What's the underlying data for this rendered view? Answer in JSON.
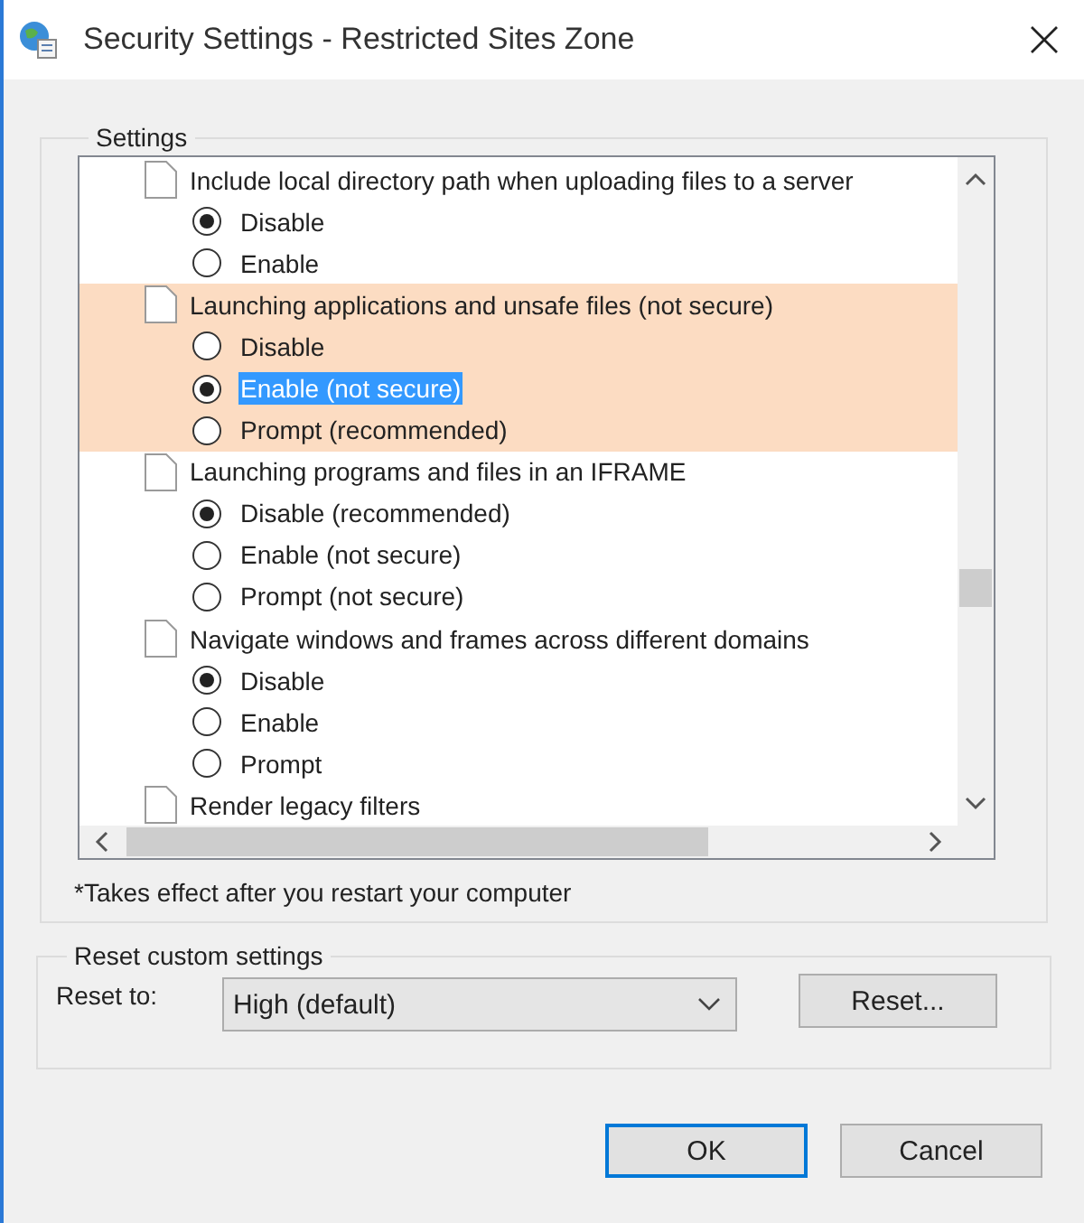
{
  "window": {
    "title": "Security Settings - Restricted Sites Zone"
  },
  "settings": {
    "title": "Settings",
    "items": [
      {
        "label": "Include local directory path when uploading files to a server",
        "highlighted": false,
        "options": [
          {
            "label": "Disable",
            "checked": true,
            "selected": false
          },
          {
            "label": "Enable",
            "checked": false,
            "selected": false
          }
        ]
      },
      {
        "label": "Launching applications and unsafe files (not secure)",
        "highlighted": true,
        "options": [
          {
            "label": "Disable",
            "checked": false,
            "selected": false
          },
          {
            "label": "Enable (not secure)",
            "checked": true,
            "selected": true
          },
          {
            "label": "Prompt (recommended)",
            "checked": false,
            "selected": false
          }
        ]
      },
      {
        "label": "Launching programs and files in an IFRAME",
        "highlighted": false,
        "options": [
          {
            "label": "Disable (recommended)",
            "checked": true,
            "selected": false
          },
          {
            "label": "Enable (not secure)",
            "checked": false,
            "selected": false
          },
          {
            "label": "Prompt (not secure)",
            "checked": false,
            "selected": false
          }
        ]
      },
      {
        "label": "Navigate windows and frames across different domains",
        "highlighted": false,
        "options": [
          {
            "label": "Disable",
            "checked": true,
            "selected": false
          },
          {
            "label": "Enable",
            "checked": false,
            "selected": false
          },
          {
            "label": "Prompt",
            "checked": false,
            "selected": false
          }
        ]
      },
      {
        "label": "Render legacy filters",
        "highlighted": false
      }
    ],
    "note": "*Takes effect after you restart your computer"
  },
  "reset": {
    "title": "Reset custom settings",
    "label": "Reset to:",
    "value": "High (default)",
    "button": "Reset..."
  },
  "buttons": [
    {
      "label": "OK",
      "default": true
    },
    {
      "label": "Cancel",
      "default": false
    }
  ]
}
